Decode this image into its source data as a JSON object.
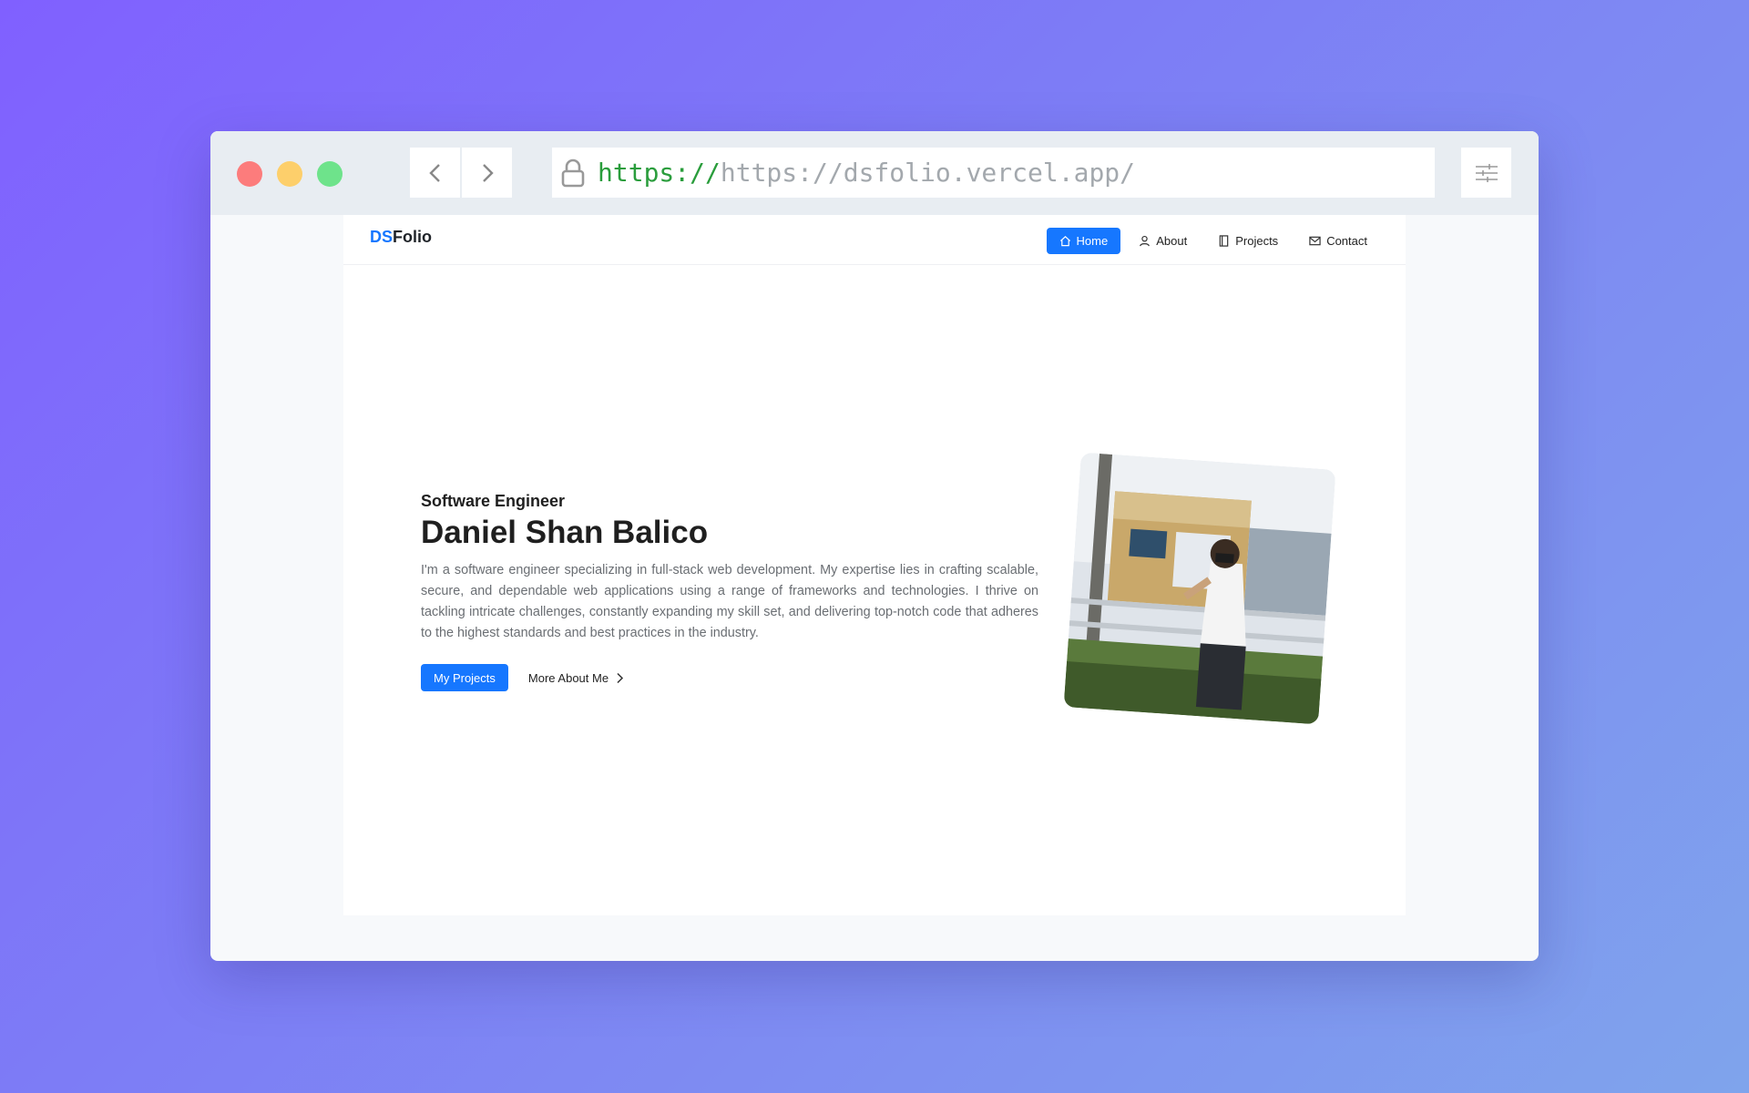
{
  "browser": {
    "url_scheme": "https://",
    "url_rest": "https://dsfolio.vercel.app/"
  },
  "site": {
    "brand_prefix": "DS",
    "brand_suffix": "Folio",
    "nav": [
      {
        "label": "Home",
        "icon": "home-icon",
        "active": true
      },
      {
        "label": "About",
        "icon": "user-icon",
        "active": false
      },
      {
        "label": "Projects",
        "icon": "book-icon",
        "active": false
      },
      {
        "label": "Contact",
        "icon": "mail-icon",
        "active": false
      }
    ]
  },
  "hero": {
    "subtitle": "Software Engineer",
    "name": "Daniel Shan Balico",
    "bio": "I'm a software engineer specializing in full-stack web development. My expertise lies in crafting scalable, secure, and dependable web applications using a range of frameworks and technologies. I thrive on tackling intricate challenges, constantly expanding my skill set, and delivering top-notch code that adheres to the highest standards and best practices in the industry.",
    "primary_button": "My Projects",
    "secondary_button": "More About Me"
  },
  "colors": {
    "accent": "#1677ff",
    "url_scheme": "#2a9d3c"
  }
}
